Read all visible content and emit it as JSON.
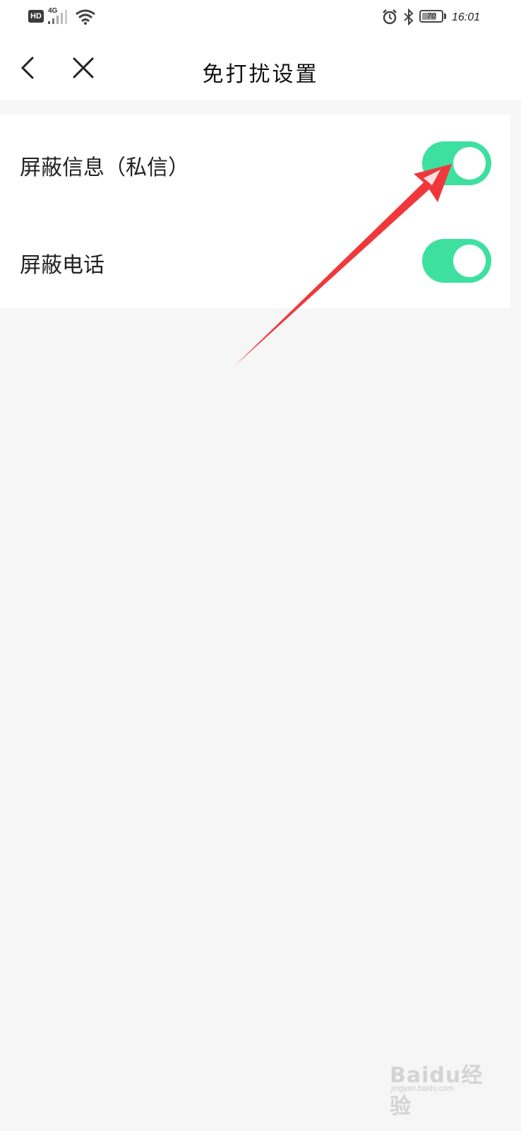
{
  "status_bar": {
    "hd_badge": "HD",
    "network": "4G",
    "battery_level": "70",
    "time": "16:01",
    "icons": [
      "signal-icon",
      "wifi-icon",
      "alarm-icon",
      "bluetooth-icon",
      "battery-icon"
    ]
  },
  "header": {
    "title": "免打扰设置",
    "back_icon": "chevron-left-icon",
    "close_icon": "close-icon"
  },
  "settings": [
    {
      "label": "屏蔽信息（私信）",
      "enabled": true
    },
    {
      "label": "屏蔽电话",
      "enabled": true
    }
  ],
  "colors": {
    "toggle_on": "#3ee0a0",
    "annotation_arrow": "#f0383c",
    "page_background": "#f6f6f6"
  },
  "watermark": {
    "text": "Baidu经验",
    "url": "jingyan.baidu.com"
  }
}
